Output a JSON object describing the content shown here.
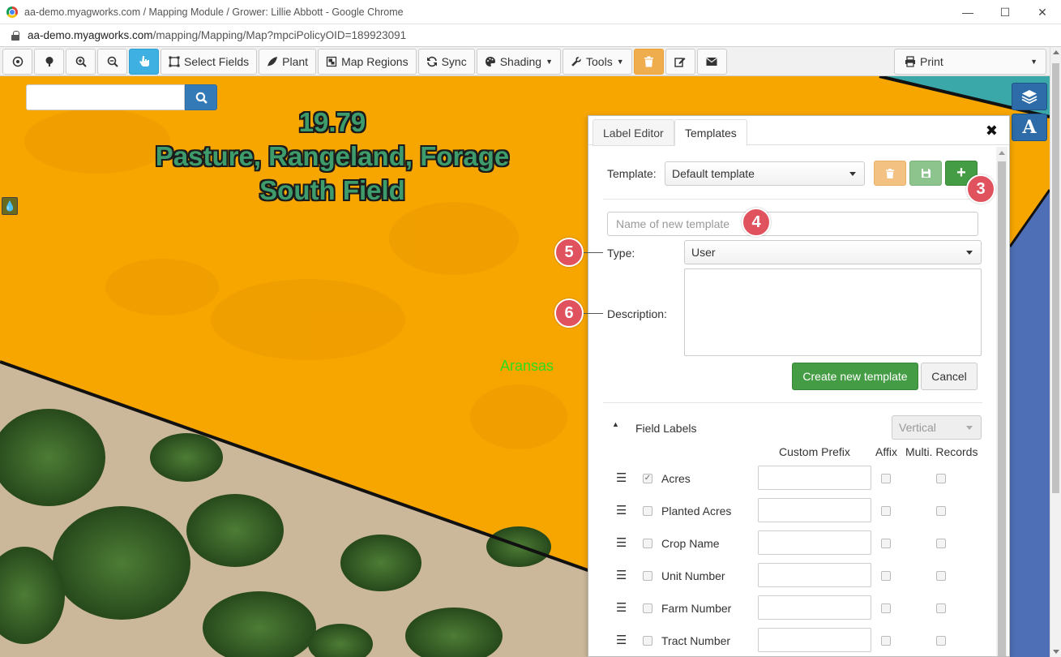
{
  "browser": {
    "title": "aa-demo.myagworks.com / Mapping Module / Grower: Lillie Abbott - Google Chrome",
    "url_host": "aa-demo.myagworks.com",
    "url_path": "/mapping/Mapping/Map?mpciPolicyOID=189923091",
    "controls": {
      "minimize": "—",
      "maximize": "☐",
      "close": "✕"
    }
  },
  "toolbar": {
    "select_fields": "Select Fields",
    "plant": "Plant",
    "map_regions": "Map Regions",
    "sync": "Sync",
    "shading": "Shading",
    "tools": "Tools",
    "print": "Print",
    "accent_active": "#3eb1e2",
    "accent_warning": "#f0ad4e"
  },
  "map": {
    "field_value": "19.79",
    "field_crop": "Pasture, Rangeland, Forage",
    "field_name": "South Field",
    "county": "Aransas",
    "search_placeholder": "",
    "field_color": "#f7a600"
  },
  "panel": {
    "tabs": [
      {
        "label": "Label Editor",
        "active": false
      },
      {
        "label": "Templates",
        "active": true
      }
    ],
    "close": "✖",
    "template_label": "Template:",
    "template_value": "Default template",
    "new_template_placeholder": "Name of new template",
    "type_label": "Type:",
    "type_value": "User",
    "description_label": "Description:",
    "create_button": "Create new template",
    "cancel_button": "Cancel",
    "section_title": "Field Labels",
    "orientation_value": "Vertical",
    "columns": {
      "custom_prefix": "Custom Prefix",
      "affix": "Affix",
      "multi_records": "Multi. Records"
    },
    "rows": [
      {
        "label": "Acres",
        "checked": true
      },
      {
        "label": "Planted Acres",
        "checked": false
      },
      {
        "label": "Crop Name",
        "checked": false
      },
      {
        "label": "Unit Number",
        "checked": false
      },
      {
        "label": "Farm Number",
        "checked": false
      },
      {
        "label": "Tract Number",
        "checked": false
      }
    ]
  },
  "markers": [
    "3",
    "4",
    "5",
    "6"
  ]
}
